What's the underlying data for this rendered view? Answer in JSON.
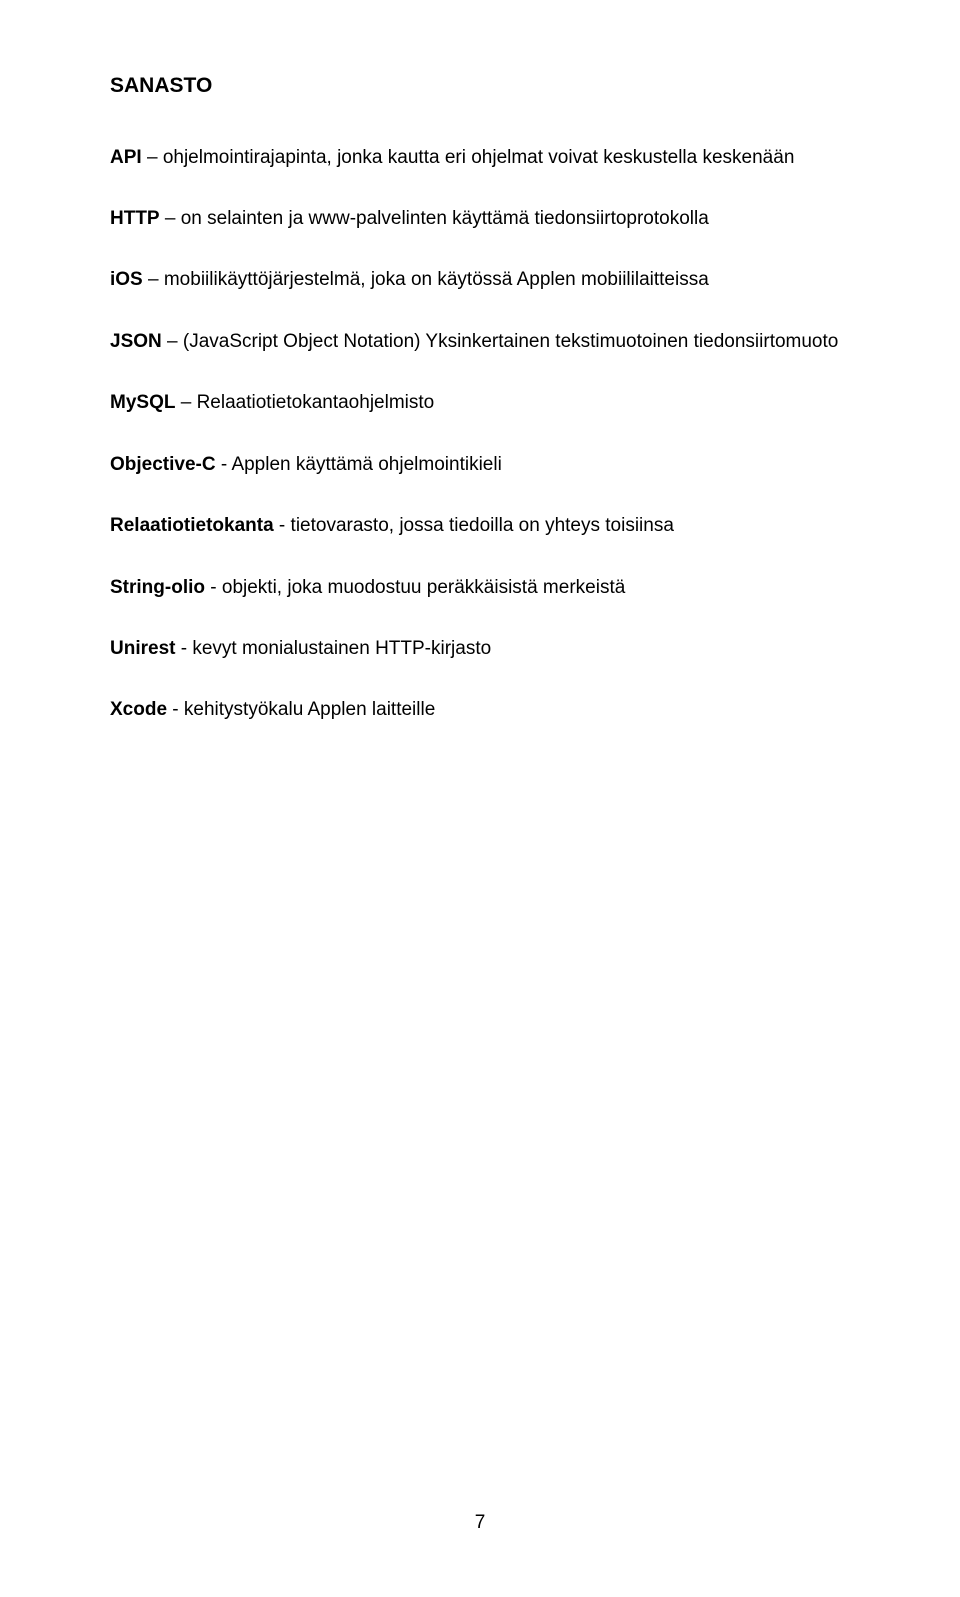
{
  "heading": "SANASTO",
  "entries": [
    {
      "term": "API",
      "sep": " – ",
      "def": "ohjelmointirajapinta, jonka kautta eri ohjelmat voivat keskustella keskenään"
    },
    {
      "term": "HTTP",
      "sep": " – ",
      "def": "on selainten ja www-palvelinten käyttämä tiedonsiirtoprotokolla"
    },
    {
      "term": "iOS",
      "sep": " – ",
      "def": "mobiilikäyttöjärjestelmä, joka on käytössä Applen mobiililaitteissa"
    },
    {
      "term": "JSON",
      "sep": " – ",
      "def": "(JavaScript Object Notation) Yksinkertainen tekstimuotoinen tiedonsiirtomuoto"
    },
    {
      "term": "MySQL",
      "sep": " – ",
      "def": "Relaatiotietokantaohjelmisto"
    },
    {
      "term": "Objective-C",
      "sep": " - ",
      "def": "Applen käyttämä ohjelmointikieli"
    },
    {
      "term": "Relaatiotietokanta",
      "sep": " - ",
      "def": "tietovarasto, jossa tiedoilla on yhteys toisiinsa"
    },
    {
      "term": "String-olio",
      "sep": " - ",
      "def": "objekti, joka muodostuu peräkkäisistä merkeistä"
    },
    {
      "term": "Unirest",
      "sep": " - ",
      "def": "kevyt monialustainen HTTP-kirjasto"
    },
    {
      "term": "Xcode",
      "sep": " - ",
      "def": "kehitystyökalu Applen laitteille"
    }
  ],
  "page_number": "7"
}
